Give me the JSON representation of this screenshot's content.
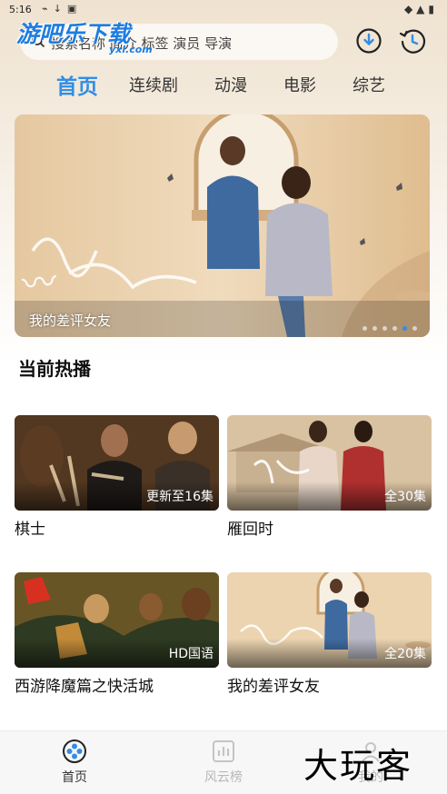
{
  "status_bar": {
    "time": "5:16"
  },
  "watermark_top": {
    "text": "游吧乐下载",
    "sub": "yxl.com"
  },
  "search": {
    "placeholder": "搜索名称 简介 标签 演员 导演"
  },
  "tabs": [
    {
      "label": "首页",
      "active": true
    },
    {
      "label": "连续剧",
      "active": false
    },
    {
      "label": "动漫",
      "active": false
    },
    {
      "label": "电影",
      "active": false
    },
    {
      "label": "综艺",
      "active": false
    }
  ],
  "banner": {
    "caption": "我的差评女友",
    "slide_count": 6,
    "active_slide": 5
  },
  "hot": {
    "title": "当前热播",
    "items": [
      {
        "title": "棋士",
        "badge": "更新至16集"
      },
      {
        "title": "雁回时",
        "badge": "全30集"
      },
      {
        "title": "西游降魔篇之快活城",
        "badge": "HD国语"
      },
      {
        "title": "我的差评女友",
        "badge": "全20集"
      }
    ]
  },
  "bottom_nav": [
    {
      "label": "首页",
      "icon": "film-reel-icon",
      "active": true
    },
    {
      "label": "风云榜",
      "icon": "chart-icon",
      "active": false
    },
    {
      "label": "我的",
      "icon": "user-icon",
      "active": false
    }
  ],
  "watermark_bottom": {
    "text": "大玩客"
  },
  "colors": {
    "accent": "#2f8ee8"
  }
}
